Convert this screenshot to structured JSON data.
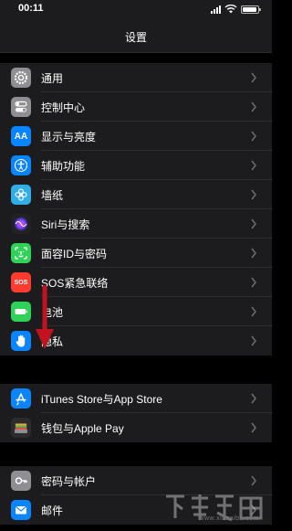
{
  "status_bar": {
    "time": "00:11",
    "signal_icon": "cellular-signal-icon",
    "wifi_icon": "wifi-icon",
    "battery_icon": "battery-icon",
    "battery_level": 0.85
  },
  "header": {
    "title": "设置"
  },
  "groups": [
    [
      {
        "label": "通用",
        "icon": "gear-icon",
        "color": "#8e8e93"
      },
      {
        "label": "控制中心",
        "icon": "toggles-icon",
        "color": "#8e8e93"
      },
      {
        "label": "显示与亮度",
        "icon": "text-size-icon",
        "color": "#0a84ff"
      },
      {
        "label": "辅助功能",
        "icon": "accessibility-icon",
        "color": "#0a84ff"
      },
      {
        "label": "墙纸",
        "icon": "flower-icon",
        "color": "#32ade6"
      },
      {
        "label": "Siri与搜索",
        "icon": "siri-icon",
        "color": "#222222"
      },
      {
        "label": "面容ID与密码",
        "icon": "face-id-icon",
        "color": "#30d158"
      },
      {
        "label": "SOS紧急联络",
        "icon": "sos-icon",
        "color": "#ff3b30",
        "icon_text": "SOS"
      },
      {
        "label": "电池",
        "icon": "battery-icon",
        "color": "#30d158"
      },
      {
        "label": "隐私",
        "icon": "hand-icon",
        "color": "#0a84ff"
      }
    ],
    [
      {
        "label": "iTunes Store与App Store",
        "icon": "app-store-icon",
        "color": "#0a84ff"
      },
      {
        "label": "钱包与Apple Pay",
        "icon": "wallet-icon",
        "color": "#2c2c2e"
      }
    ],
    [
      {
        "label": "密码与帐户",
        "icon": "key-icon",
        "color": "#8e8e93"
      },
      {
        "label": "邮件",
        "icon": "mail-icon",
        "color": "#0a84ff"
      }
    ]
  ],
  "watermark": {
    "text": "www.xiazaiba.com",
    "logo": "watermark-logo"
  }
}
